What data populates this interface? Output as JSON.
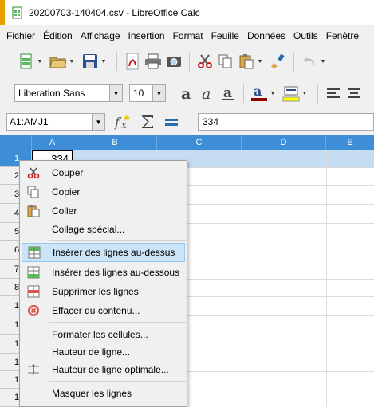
{
  "window": {
    "title": "20200703-140404.csv - LibreOffice Calc"
  },
  "menubar": [
    {
      "label": "Fichier"
    },
    {
      "label": "Édition"
    },
    {
      "label": "Affichage"
    },
    {
      "label": "Insertion"
    },
    {
      "label": "Format"
    },
    {
      "label": "Feuille"
    },
    {
      "label": "Données"
    },
    {
      "label": "Outils"
    },
    {
      "label": "Fenêtre"
    }
  ],
  "toolbar2": {
    "font_name": "Liberation Sans",
    "font_size": "10"
  },
  "formula_bar": {
    "name_box": "A1:AMJ1",
    "input": "334"
  },
  "grid": {
    "columns": [
      "A",
      "B",
      "C",
      "D",
      "E"
    ],
    "rows": [
      "1",
      "2",
      "3",
      "4",
      "5",
      "6",
      "7",
      "8",
      "1",
      "1",
      "1",
      "1",
      "1",
      "1"
    ],
    "cell_a1": "334"
  },
  "context_menu": {
    "items": [
      {
        "label": "Couper",
        "icon": "scissors-icon"
      },
      {
        "label": "Copier",
        "icon": "copy-icon"
      },
      {
        "label": "Coller",
        "icon": "paste-icon"
      },
      {
        "label": "Collage spécial...",
        "icon": ""
      },
      {
        "label": "Insérer des lignes au-dessus",
        "icon": "insert-rows-above-icon",
        "highlighted": true
      },
      {
        "label": "Insérer des lignes au-dessous",
        "icon": "insert-rows-below-icon"
      },
      {
        "label": "Supprimer les lignes",
        "icon": "delete-rows-icon"
      },
      {
        "label": "Effacer du contenu...",
        "icon": "clear-contents-icon"
      },
      {
        "label": "Formater les cellules...",
        "icon": ""
      },
      {
        "label": "Hauteur de ligne...",
        "icon": ""
      },
      {
        "label": "Hauteur de ligne optimale...",
        "icon": "optimal-row-height-icon"
      },
      {
        "label": "Masquer les lignes",
        "icon": ""
      }
    ]
  },
  "colors": {
    "header_blue": "#3d8ed6",
    "selection_row": "#c6dcf3",
    "menu_highlight": "#cce4f7"
  }
}
